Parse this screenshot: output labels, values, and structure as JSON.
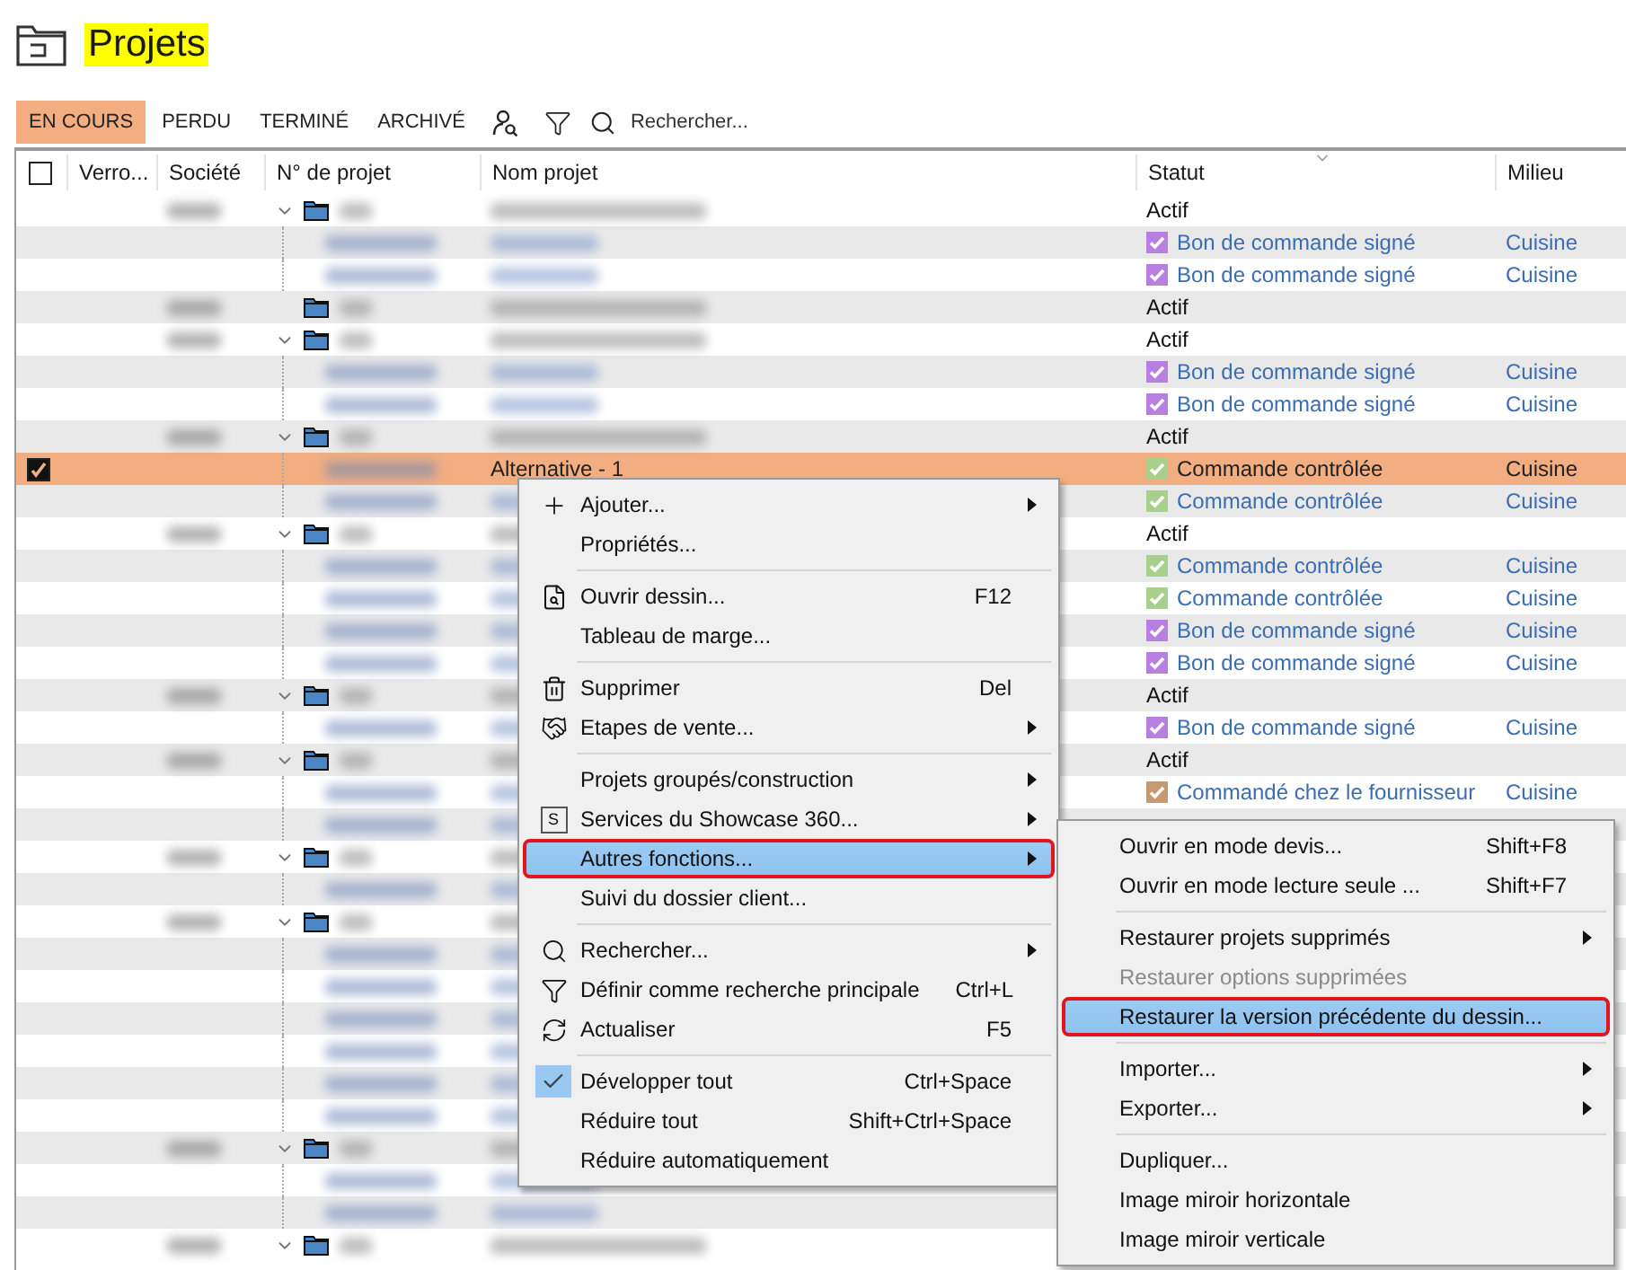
{
  "page": {
    "title": "Projets"
  },
  "toolbar": {
    "tabs": [
      {
        "label": "EN COURS",
        "selected": true
      },
      {
        "label": "PERDU",
        "selected": false
      },
      {
        "label": "TERMINÉ",
        "selected": false
      },
      {
        "label": "ARCHIVÉ",
        "selected": false
      }
    ],
    "search": {
      "placeholder": "Rechercher..."
    }
  },
  "table": {
    "select_all": {
      "checked": false
    },
    "columns": [
      "Verro...",
      "Société",
      "N° de projet",
      "Nom projet",
      "Statut",
      "Milieu"
    ],
    "rows": [
      {
        "kind": "parent",
        "expanded": true,
        "selected": false,
        "checked": false,
        "status": "Actif"
      },
      {
        "kind": "child",
        "selected": false,
        "checked": false,
        "status": "Bon de commande signé",
        "color": "#b87fe0",
        "milieu": "Cuisine"
      },
      {
        "kind": "child",
        "selected": false,
        "checked": false,
        "status": "Bon de commande signé",
        "color": "#b87fe0",
        "milieu": "Cuisine"
      },
      {
        "kind": "parent",
        "expanded": false,
        "selected": false,
        "checked": false,
        "status": "Actif"
      },
      {
        "kind": "parent",
        "expanded": true,
        "selected": false,
        "checked": false,
        "status": "Actif"
      },
      {
        "kind": "child",
        "selected": false,
        "checked": false,
        "status": "Bon de commande signé",
        "color": "#b87fe0",
        "milieu": "Cuisine"
      },
      {
        "kind": "child",
        "selected": false,
        "checked": false,
        "status": "Bon de commande signé",
        "color": "#b87fe0",
        "milieu": "Cuisine"
      },
      {
        "kind": "parent",
        "expanded": true,
        "selected": false,
        "checked": false,
        "status": "Actif"
      },
      {
        "kind": "child",
        "selected": true,
        "checked": true,
        "name": "Alternative - 1",
        "status": "Commande contrôlée",
        "color": "#a8cf8c",
        "milieu": "Cuisine"
      },
      {
        "kind": "child",
        "selected": false,
        "checked": false,
        "status": "Commande contrôlée",
        "color": "#a8cf8c",
        "milieu": "Cuisine"
      },
      {
        "kind": "parent",
        "expanded": true,
        "selected": false,
        "checked": false,
        "status": "Actif"
      },
      {
        "kind": "child",
        "selected": false,
        "checked": false,
        "status": "Commande contrôlée",
        "color": "#a8cf8c",
        "milieu": "Cuisine"
      },
      {
        "kind": "child",
        "selected": false,
        "checked": false,
        "status": "Commande contrôlée",
        "color": "#a8cf8c",
        "milieu": "Cuisine"
      },
      {
        "kind": "child",
        "selected": false,
        "checked": false,
        "status": "Bon de commande signé",
        "color": "#b87fe0",
        "milieu": "Cuisine"
      },
      {
        "kind": "child",
        "selected": false,
        "checked": false,
        "status": "Bon de commande signé",
        "color": "#b87fe0",
        "milieu": "Cuisine"
      },
      {
        "kind": "parent",
        "expanded": true,
        "selected": false,
        "checked": false,
        "status": "Actif"
      },
      {
        "kind": "child",
        "selected": false,
        "checked": false,
        "status": "Bon de commande signé",
        "color": "#b87fe0",
        "milieu": "Cuisine"
      },
      {
        "kind": "parent",
        "expanded": true,
        "selected": false,
        "checked": false,
        "status": "Actif"
      },
      {
        "kind": "child",
        "selected": false,
        "checked": false,
        "status": "Commandé chez le fournisseur",
        "color": "#c49a72",
        "milieu": "Cuisine"
      },
      {
        "kind": "child",
        "selected": false,
        "checked": false
      },
      {
        "kind": "parent",
        "expanded": true,
        "selected": false,
        "checked": false
      },
      {
        "kind": "child",
        "selected": false,
        "checked": false
      },
      {
        "kind": "parent",
        "expanded": true,
        "selected": false,
        "checked": false
      },
      {
        "kind": "child",
        "selected": false,
        "checked": false
      },
      {
        "kind": "child",
        "selected": false,
        "checked": false
      },
      {
        "kind": "child",
        "selected": false,
        "checked": false
      },
      {
        "kind": "child",
        "selected": false,
        "checked": false
      },
      {
        "kind": "child",
        "selected": false,
        "checked": false
      },
      {
        "kind": "child",
        "selected": false,
        "checked": false
      },
      {
        "kind": "parent",
        "expanded": true,
        "selected": false,
        "checked": false
      },
      {
        "kind": "child",
        "selected": false,
        "checked": false
      },
      {
        "kind": "child",
        "selected": false,
        "checked": false
      },
      {
        "kind": "parent",
        "expanded": true,
        "selected": false,
        "checked": false
      }
    ]
  },
  "context_menu": {
    "items": [
      {
        "kind": "item",
        "label": "Ajouter...",
        "submenu": true,
        "highlighted": false
      },
      {
        "kind": "item",
        "label": "Propriétés...",
        "submenu": false,
        "highlighted": false
      },
      {
        "kind": "separator"
      },
      {
        "kind": "item",
        "label": "Ouvrir dessin...",
        "shortcut": "F12",
        "submenu": false,
        "highlighted": false
      },
      {
        "kind": "item",
        "label": "Tableau de marge...",
        "submenu": false,
        "highlighted": false
      },
      {
        "kind": "separator"
      },
      {
        "kind": "item",
        "label": "Supprimer",
        "shortcut": "Del",
        "submenu": false,
        "highlighted": false
      },
      {
        "kind": "item",
        "label": "Etapes de vente...",
        "submenu": true,
        "highlighted": false
      },
      {
        "kind": "separator"
      },
      {
        "kind": "item",
        "label": "Projets groupés/construction",
        "submenu": true,
        "highlighted": false
      },
      {
        "kind": "item",
        "icon_text": "S",
        "label": "Services du Showcase 360...",
        "submenu": true,
        "highlighted": false
      },
      {
        "kind": "item",
        "label": "Autres fonctions...",
        "submenu": true,
        "highlighted": true
      },
      {
        "kind": "item",
        "label": "Suivi du dossier client...",
        "submenu": false,
        "highlighted": false
      },
      {
        "kind": "separator"
      },
      {
        "kind": "item",
        "label": "Rechercher...",
        "submenu": true,
        "highlighted": false
      },
      {
        "kind": "item",
        "label": "Définir comme recherche principale",
        "shortcut": "Ctrl+L",
        "submenu": false,
        "highlighted": false
      },
      {
        "kind": "item",
        "label": "Actualiser",
        "shortcut": "F5",
        "submenu": false,
        "highlighted": false
      },
      {
        "kind": "separator"
      },
      {
        "kind": "item",
        "checked": true,
        "label": "Développer tout",
        "shortcut": "Ctrl+Space",
        "submenu": false,
        "highlighted": false
      },
      {
        "kind": "item",
        "label": "Réduire tout",
        "shortcut": "Shift+Ctrl+Space",
        "submenu": false,
        "highlighted": false
      },
      {
        "kind": "item",
        "label": "Réduire automatiquement",
        "submenu": false,
        "highlighted": false
      }
    ]
  },
  "submenu": {
    "items": [
      {
        "kind": "item",
        "label": "Ouvrir en mode devis...",
        "shortcut": "Shift+F8",
        "submenu": false,
        "highlighted": false,
        "disabled": false
      },
      {
        "kind": "item",
        "label": "Ouvrir en mode lecture seule ...",
        "shortcut": "Shift+F7",
        "submenu": false,
        "highlighted": false,
        "disabled": false
      },
      {
        "kind": "separator"
      },
      {
        "kind": "item",
        "label": "Restaurer projets supprimés",
        "submenu": true,
        "highlighted": false,
        "disabled": false
      },
      {
        "kind": "item",
        "label": "Restaurer options supprimées",
        "submenu": false,
        "highlighted": false,
        "disabled": true
      },
      {
        "kind": "item",
        "label": "Restaurer la version précédente du dessin...",
        "submenu": false,
        "highlighted": true,
        "disabled": false
      },
      {
        "kind": "separator"
      },
      {
        "kind": "item",
        "label": "Importer...",
        "submenu": true,
        "highlighted": false,
        "disabled": false
      },
      {
        "kind": "item",
        "label": "Exporter...",
        "submenu": true,
        "highlighted": false,
        "disabled": false
      },
      {
        "kind": "separator"
      },
      {
        "kind": "item",
        "label": "Dupliquer...",
        "submenu": false,
        "highlighted": false,
        "disabled": false
      },
      {
        "kind": "item",
        "label": "Image miroir horizontale",
        "submenu": false,
        "highlighted": false,
        "disabled": false
      },
      {
        "kind": "item",
        "label": "Image miroir verticale",
        "submenu": false,
        "highlighted": false,
        "disabled": false
      }
    ]
  }
}
